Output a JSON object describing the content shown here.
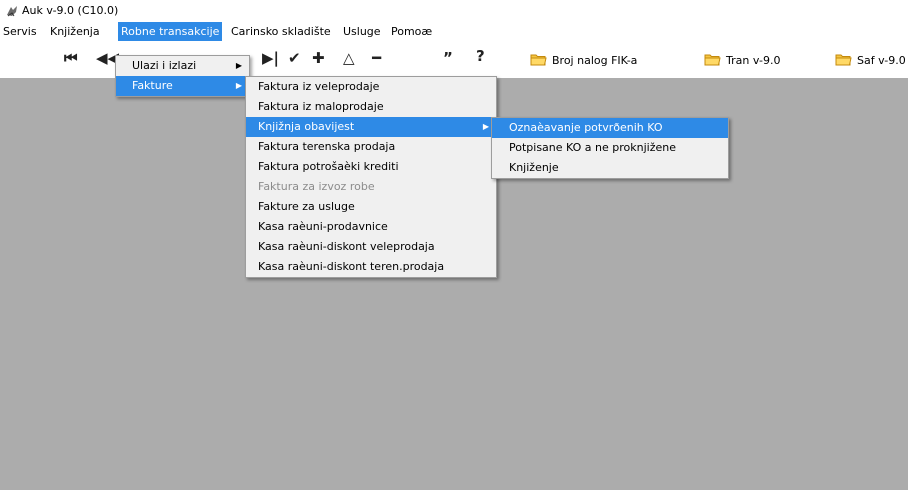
{
  "window": {
    "title": "Auk v-9.0 (C10.0)",
    "icon": "app-icon"
  },
  "menubar": {
    "items": [
      {
        "label": "Servis"
      },
      {
        "label": "Knjiženja"
      },
      {
        "label": "Robne transakcije",
        "active": true
      },
      {
        "label": "Carinsko skladište"
      },
      {
        "label": "Usluge"
      },
      {
        "label": "Pomoæ"
      }
    ]
  },
  "toolbar": {
    "nav_first": "first-record-icon",
    "nav_prev": "previous-page-icon",
    "nav_last": "last-record-icon",
    "confirm": "check-icon",
    "add": "plus-icon",
    "up": "triangle-up-icon",
    "remove": "minus-icon",
    "quote": "quote-icon",
    "help": "question-icon",
    "buttons": [
      {
        "label": "Broj nalog FIK-a",
        "icon": "folder-icon"
      },
      {
        "label": "Tran v-9.0",
        "icon": "folder-icon"
      },
      {
        "label": "Saf v-9.0",
        "icon": "folder-icon"
      }
    ]
  },
  "robne_menu": {
    "items": [
      {
        "label": "Ulazi i izlazi",
        "submenu": true
      },
      {
        "label": "Fakture",
        "submenu": true,
        "highlighted": true
      }
    ]
  },
  "fakture_menu": {
    "items": [
      {
        "label": "Faktura iz veleprodaje"
      },
      {
        "label": "Faktura iz maloprodaje"
      },
      {
        "label": "Knjižnja obavijest",
        "submenu": true,
        "highlighted": true
      },
      {
        "label": "Faktura terenska prodaja"
      },
      {
        "label": "Faktura potrošaèki krediti"
      },
      {
        "label": "Faktura za izvoz robe",
        "disabled": true
      },
      {
        "label": "Fakture za usluge"
      },
      {
        "label": "Kasa raèuni-prodavnice"
      },
      {
        "label": "Kasa raèuni-diskont veleprodaja"
      },
      {
        "label": "Kasa raèuni-diskont teren.prodaja"
      }
    ]
  },
  "knjizna_menu": {
    "items": [
      {
        "label": "Oznaèavanje potvrðenih KO",
        "highlighted": true
      },
      {
        "label": "Potpisane KO a ne proknjižene"
      },
      {
        "label": "Knjiženje"
      }
    ]
  },
  "colors": {
    "highlight": "#2e8ae6",
    "workarea": "#acacac",
    "menu_bg": "#f0f0f0",
    "disabled_text": "#8c8c8c"
  }
}
